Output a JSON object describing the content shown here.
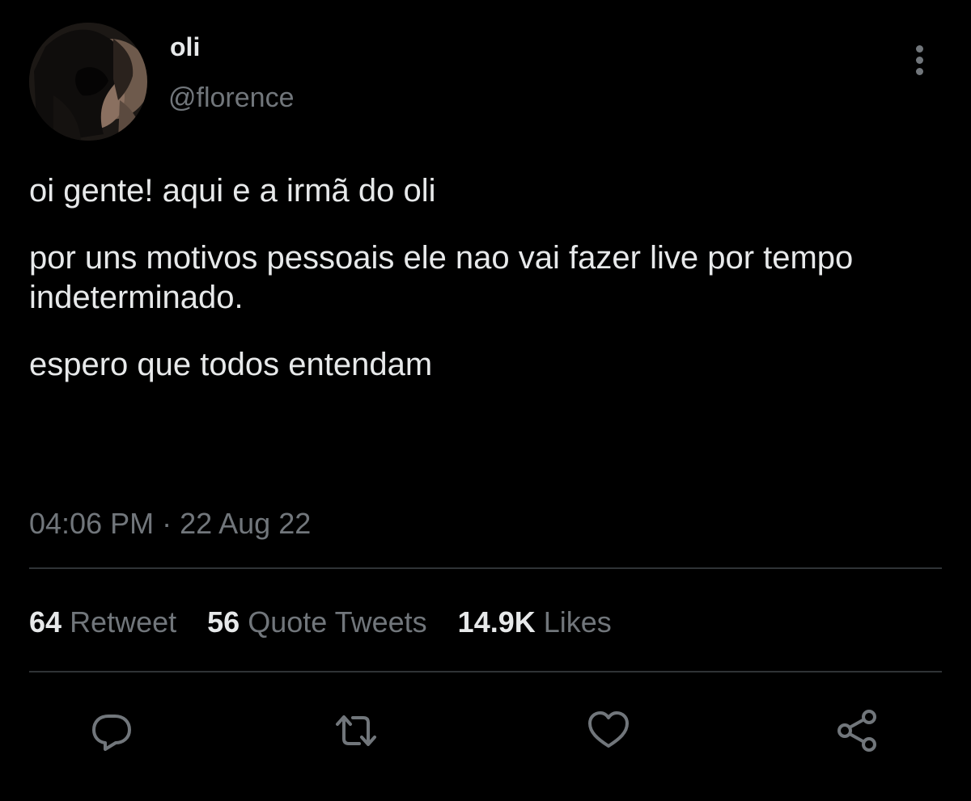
{
  "tweet": {
    "display_name": "oli",
    "handle": "@florence",
    "paragraphs": [
      "oi gente! aqui e a irmã do oli",
      "por uns motivos pessoais ele nao vai fazer live por tempo indeterminado.",
      "espero que todos entendam"
    ],
    "timestamp": "04:06 PM · 22 Aug 22"
  },
  "stats": [
    {
      "count": "64",
      "label": "Retweet"
    },
    {
      "count": "56",
      "label": "Quote Tweets"
    },
    {
      "count": "14.9K",
      "label": "Likes"
    }
  ],
  "icons": {
    "avatar": "avatar-image",
    "more": "more-vertical-icon",
    "reply": "reply-icon",
    "retweet": "retweet-icon",
    "like": "heart-icon",
    "share": "share-icon"
  },
  "colors": {
    "background": "#000000",
    "primary_text": "#e7e9ea",
    "secondary_text": "#71767b",
    "divider": "#2f3336"
  }
}
